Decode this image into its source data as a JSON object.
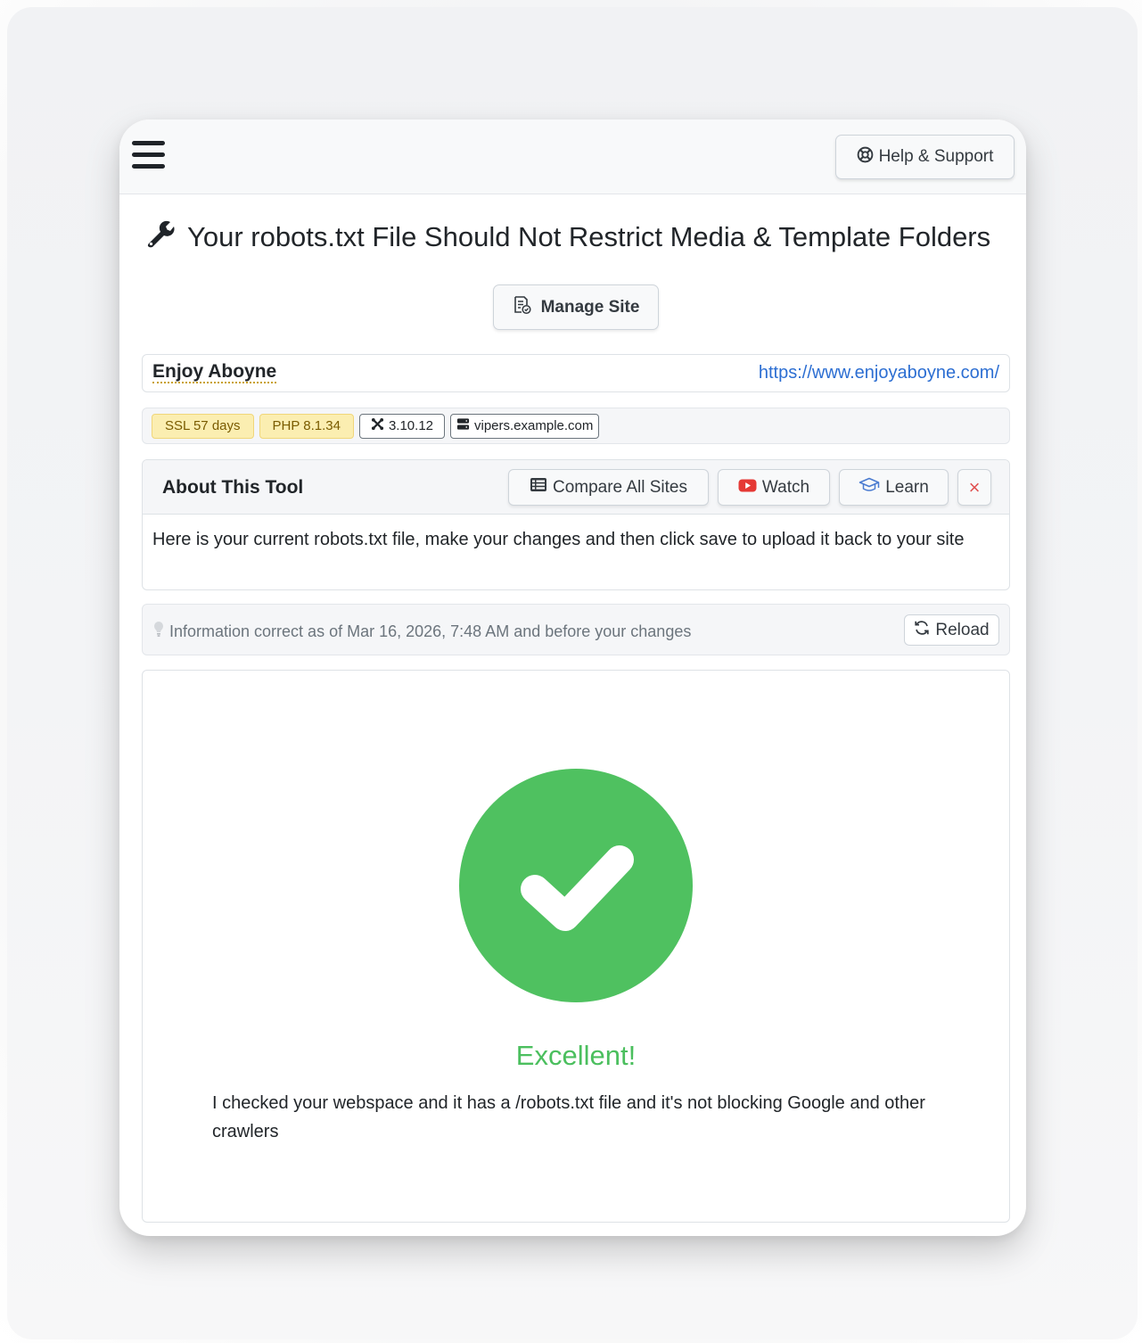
{
  "header": {
    "help_label": "Help & Support"
  },
  "page": {
    "title": "Your robots.txt File Should Not Restrict Media & Template Folders",
    "manage_site_label": "Manage Site"
  },
  "site": {
    "name": "Enjoy Aboyne",
    "url": "https://www.enjoyaboyne.com/"
  },
  "badges": {
    "ssl": "SSL 57 days",
    "php": "PHP 8.1.34",
    "cms_version": "3.10.12",
    "host": "vipers.example.com"
  },
  "about": {
    "title": "About This Tool",
    "compare_label": "Compare All Sites",
    "watch_label": "Watch",
    "learn_label": "Learn",
    "close_glyph": "×",
    "description": "Here is your current robots.txt file, make your changes and then click save to upload it back to your site"
  },
  "info": {
    "text": "Information correct as of Mar 16, 2026, 7:48 AM and before your changes",
    "reload_label": "Reload"
  },
  "result": {
    "heading": "Excellent!",
    "message": "I checked your webspace and it has a /robots.txt file and it's not blocking Google and other crawlers"
  },
  "colors": {
    "success": "#4fc160",
    "link": "#2c6ed2",
    "warning_badge": "#fbeeb1",
    "youtube_red": "#e53935"
  }
}
